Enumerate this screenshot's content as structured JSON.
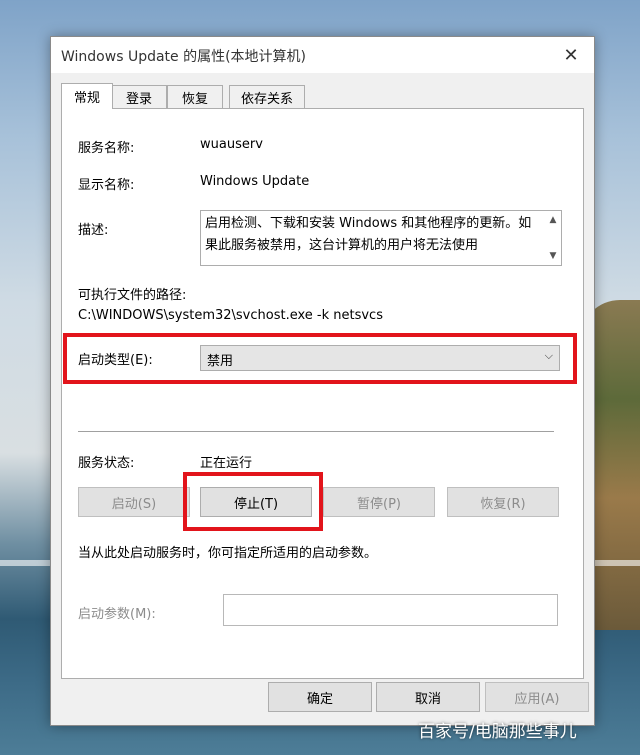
{
  "window": {
    "title": "Windows Update 的属性(本地计算机)",
    "close_glyph": "✕"
  },
  "tabs": [
    {
      "label": "常规",
      "active": true
    },
    {
      "label": "登录",
      "active": false
    },
    {
      "label": "恢复",
      "active": false
    },
    {
      "label": "依存关系",
      "active": false
    }
  ],
  "general": {
    "service_name_label": "服务名称:",
    "service_name_value": "wuauserv",
    "display_name_label": "显示名称:",
    "display_name_value": "Windows Update",
    "description_label": "描述:",
    "description_value": "启用检测、下载和安装 Windows 和其他程序的更新。如果此服务被禁用，这台计算机的用户将无法使用",
    "exe_path_label": "可执行文件的路径:",
    "exe_path_value": "C:\\WINDOWS\\system32\\svchost.exe -k netsvcs",
    "startup_type_label": "启动类型(E):",
    "startup_type_value": "禁用",
    "service_status_label": "服务状态:",
    "service_status_value": "正在运行"
  },
  "service_buttons": {
    "start": "启动(S)",
    "stop": "停止(T)",
    "pause": "暂停(P)",
    "resume": "恢复(R)"
  },
  "start_hint": "当从此处启动服务时，你可指定所适用的启动参数。",
  "start_params": {
    "label": "启动参数(M):",
    "value": ""
  },
  "footer": {
    "ok": "确定",
    "cancel": "取消",
    "apply": "应用(A)"
  },
  "watermark": "百家号/电脑那些事儿",
  "colors": {
    "highlight": "#e2141b",
    "dialog_bg": "#f0f0f0",
    "focus_border": "#0078d7"
  },
  "icons": {
    "close": "close-icon",
    "chevron": "chevron-down-icon",
    "scroll_up": "scroll-up-icon",
    "scroll_down": "scroll-down-icon"
  }
}
